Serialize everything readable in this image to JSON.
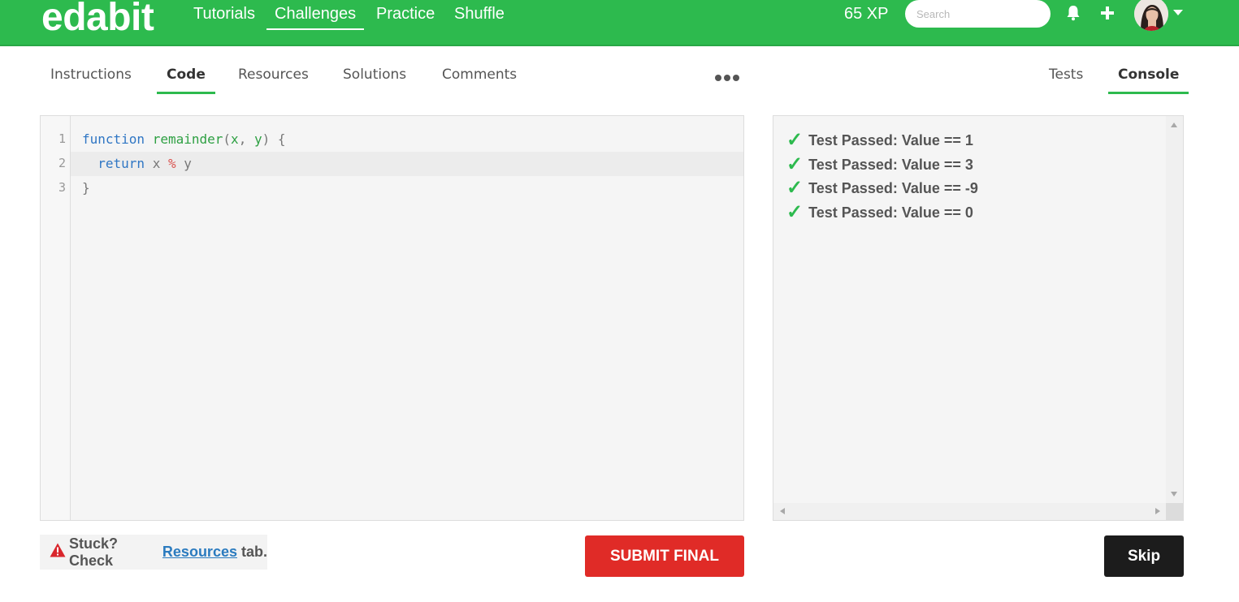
{
  "header": {
    "logo": "edabit",
    "nav": [
      {
        "label": "Tutorials"
      },
      {
        "label": "Challenges"
      },
      {
        "label": "Practice"
      },
      {
        "label": "Shuffle"
      }
    ],
    "active_nav": "Challenges",
    "xp": "65 XP",
    "search_placeholder": "Search",
    "icons": [
      "bell-icon",
      "plus-icon",
      "avatar",
      "caret-down-icon"
    ]
  },
  "left_tabs": [
    {
      "label": "Instructions"
    },
    {
      "label": "Code"
    },
    {
      "label": "Resources"
    },
    {
      "label": "Solutions"
    },
    {
      "label": "Comments"
    }
  ],
  "active_left_tab": "Code",
  "right_tabs": [
    {
      "label": "Tests"
    },
    {
      "label": "Console"
    }
  ],
  "active_right_tab": "Console",
  "editor": {
    "line_numbers": [
      "1",
      "2",
      "3"
    ],
    "lines": [
      {
        "kw": "function",
        "fn": "remainder",
        "p1": "(",
        "a1": "x",
        "comma": ", ",
        "a2": "y",
        "p2": ") {"
      },
      {
        "kw": "return",
        "v1": " x ",
        "op": "%",
        "v2": " y"
      },
      {
        "text": "}"
      }
    ]
  },
  "console": {
    "results": [
      "Test Passed: Value == 1",
      "Test Passed: Value == 3",
      "Test Passed: Value == -9",
      "Test Passed: Value == 0"
    ]
  },
  "footer": {
    "hint_prefix": "Stuck? Check",
    "hint_link": "Resources",
    "hint_suffix": "tab.",
    "submit_label": "SUBMIT FINAL",
    "skip_label": "Skip"
  },
  "colors": {
    "brand_green": "#2dba4e",
    "submit_red": "#e02b27",
    "skip_dark": "#1c1c1c",
    "link_blue": "#2b7bbf"
  }
}
